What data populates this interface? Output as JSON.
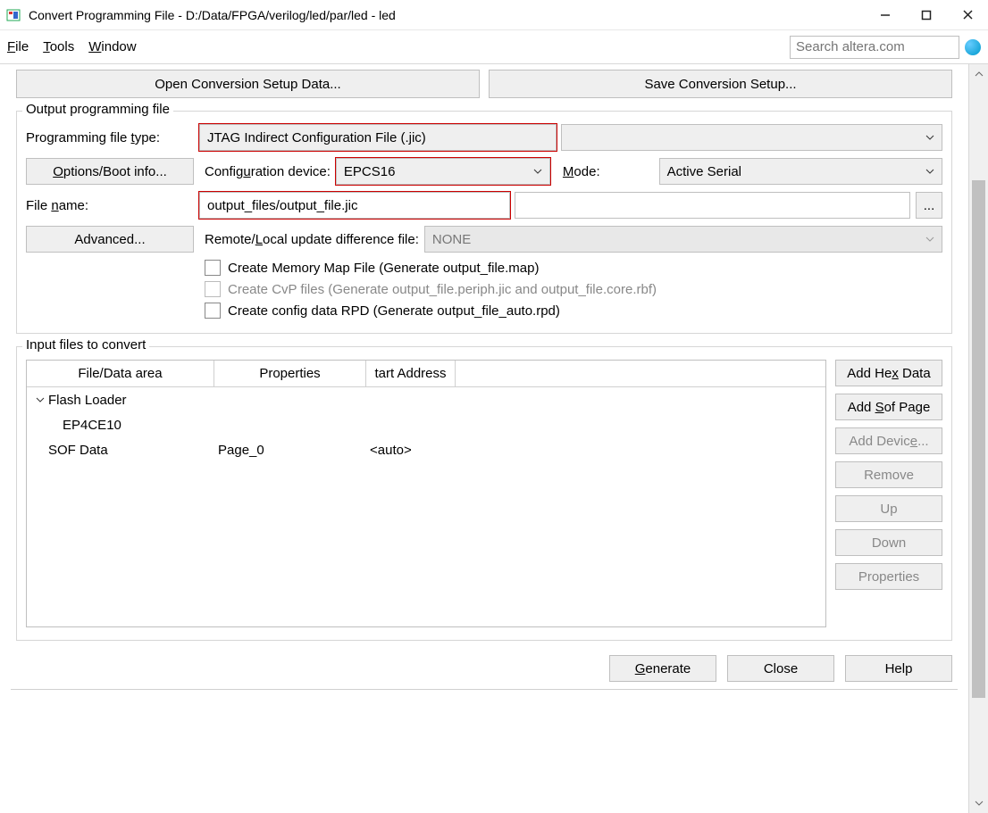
{
  "titlebar": {
    "title": "Convert Programming File - D:/Data/FPGA/verilog/led/par/led - led"
  },
  "menu": {
    "file": "File",
    "tools": "Tools",
    "window": "Window",
    "search_placeholder": "Search altera.com"
  },
  "topbtns": {
    "open": "Open Conversion Setup Data...",
    "save": "Save Conversion Setup..."
  },
  "output_group": {
    "legend": "Output programming file",
    "prog_type_label": "Programming file type:",
    "prog_type_value": "JTAG Indirect Configuration File (.jic)",
    "options_btn": "Options/Boot info...",
    "config_device_label": "Configuration device:",
    "config_device_value": "EPCS16",
    "mode_label": "Mode:",
    "mode_value": "Active Serial",
    "filename_label": "File name:",
    "filename_value": "output_files/output_file.jic",
    "browse_btn": "...",
    "advanced_btn": "Advanced...",
    "remote_label": "Remote/Local update difference file:",
    "remote_value": "NONE",
    "cb_memmap": "Create Memory Map File (Generate output_file.map)",
    "cb_cvp": "Create CvP files (Generate output_file.periph.jic and output_file.core.rbf)",
    "cb_rpd": "Create config data RPD (Generate output_file_auto.rpd)"
  },
  "input_group": {
    "legend": "Input files to convert",
    "headers": {
      "c1": "File/Data area",
      "c2": "Properties",
      "c3": "tart Address"
    },
    "rows": {
      "flash_loader": "Flash Loader",
      "ep4ce10": "EP4CE10",
      "sof_data": "SOF Data",
      "sof_prop": "Page_0",
      "sof_addr": "<auto>"
    },
    "sidebtns": {
      "add_hex": "Add Hex Data",
      "add_sof": "Add Sof Page",
      "add_device": "Add Device...",
      "remove": "Remove",
      "up": "Up",
      "down": "Down",
      "properties": "Properties"
    }
  },
  "bottom": {
    "generate": "Generate",
    "close": "Close",
    "help": "Help"
  }
}
